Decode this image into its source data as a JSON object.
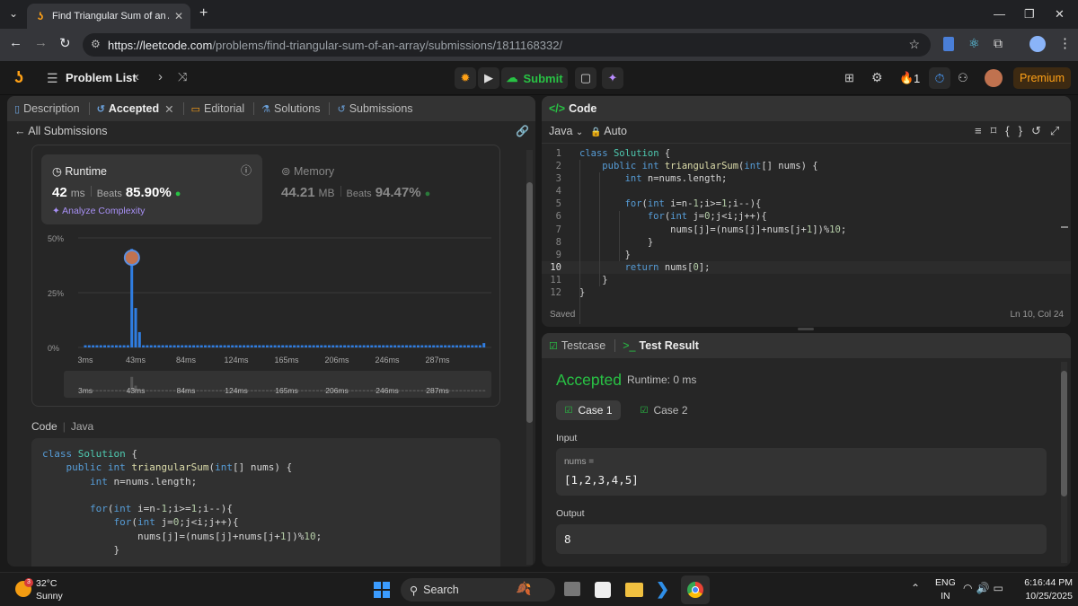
{
  "browser": {
    "tab_title": "Find Triangular Sum of an Array",
    "url_host": "https://leetcode.com",
    "url_path": "/problems/find-triangular-sum-of-an-array/submissions/1811168332/"
  },
  "header": {
    "problem_list": "Problem List",
    "submit": "Submit",
    "streak": "1",
    "premium": "Premium"
  },
  "left_tabs": [
    "Description",
    "Accepted",
    "Editorial",
    "Solutions",
    "Submissions"
  ],
  "all_submissions": "All Submissions",
  "runtime": {
    "label": "Runtime",
    "value": "42",
    "unit": "ms",
    "beats_label": "Beats",
    "beats": "85.90%",
    "analyze": "Analyze Complexity"
  },
  "memory": {
    "label": "Memory",
    "value": "44.21",
    "unit": "MB",
    "beats_label": "Beats",
    "beats": "94.47%"
  },
  "chart_data": {
    "type": "bar",
    "y_ticks": [
      "50%",
      "25%",
      "0%"
    ],
    "x_ticks": [
      "3ms",
      "43ms",
      "84ms",
      "124ms",
      "165ms",
      "206ms",
      "246ms",
      "287ms"
    ],
    "ylim": [
      0,
      50
    ],
    "values": [
      1,
      1,
      1,
      1,
      1,
      1,
      1,
      1,
      1,
      1,
      1,
      1,
      45,
      18,
      7,
      1,
      1,
      1,
      1,
      1,
      1,
      1,
      1,
      1,
      1,
      1,
      1,
      1,
      1,
      1,
      1,
      1,
      1,
      1,
      1,
      1,
      1,
      1,
      1,
      1,
      1,
      1,
      1,
      1,
      1,
      1,
      1,
      1,
      1,
      1,
      1,
      1,
      1,
      1,
      1,
      1,
      1,
      1,
      1,
      1,
      1,
      1,
      1,
      1,
      1,
      1,
      1,
      1,
      1,
      1,
      1,
      1,
      1,
      1,
      1,
      1,
      1,
      1,
      1,
      1,
      1,
      1,
      1,
      1,
      1,
      1,
      1,
      1,
      1,
      1,
      1,
      1,
      1,
      1,
      1,
      1,
      1,
      1,
      1,
      1,
      1,
      1,
      1,
      2
    ]
  },
  "left_code": {
    "label": "Code",
    "lang": "Java",
    "lines": [
      "class Solution {",
      "    public int triangularSum(int[] nums) {",
      "        int n=nums.length;",
      "",
      "        for(int i=n-1;i>=1;i--){",
      "            for(int j=0;j<i;j++){",
      "                nums[j]=(nums[j]+nums[j+1])%10;",
      "            }"
    ]
  },
  "editor": {
    "title": "Code",
    "lang": "Java",
    "mode": "Auto",
    "lines": [
      "class Solution {",
      "    public int triangularSum(int[] nums) {",
      "        int n=nums.length;",
      "",
      "        for(int i=n-1;i>=1;i--){",
      "            for(int j=0;j<i;j++){",
      "                nums[j]=(nums[j]+nums[j+1])%10;",
      "            }",
      "        }",
      "        return nums[0];",
      "    }",
      "}"
    ],
    "line_numbers": [
      "1",
      "2",
      "3",
      "4",
      "5",
      "6",
      "7",
      "8",
      "9",
      "10",
      "11",
      "12"
    ],
    "saved": "Saved",
    "cursor": "Ln 10, Col 24"
  },
  "result": {
    "tab_testcase": "Testcase",
    "tab_result": "Test Result",
    "status": "Accepted",
    "runtime": "Runtime: 0 ms",
    "case1": "Case 1",
    "case2": "Case 2",
    "input_label": "Input",
    "input_var": "nums =",
    "input_value": "[1,2,3,4,5]",
    "output_label": "Output",
    "output_value": "8"
  },
  "taskbar": {
    "temp": "32°C",
    "weather": "Sunny",
    "badge": "3",
    "search": "Search",
    "lang1": "ENG",
    "lang2": "IN",
    "time": "6:16:44 PM",
    "date": "10/25/2025"
  }
}
